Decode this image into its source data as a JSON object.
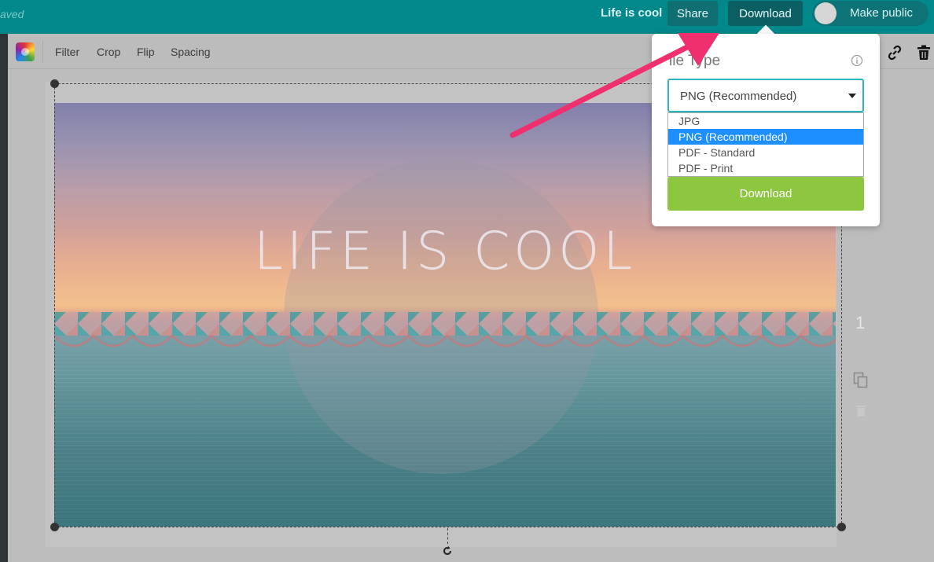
{
  "header": {
    "saved_text": "aved",
    "doc_title": "Life is cool",
    "share_label": "Share",
    "download_label": "Download",
    "make_public_label": "Make public"
  },
  "toolbar": {
    "items": [
      "Filter",
      "Crop",
      "Flip",
      "Spacing"
    ]
  },
  "design": {
    "headline": "LIFE IS COOL"
  },
  "page_number": "1",
  "download_popover": {
    "file_type_label": "ile Type",
    "selected_value": "PNG (Recommended)",
    "options": [
      "JPG",
      "PNG (Recommended)",
      "PDF - Standard",
      "PDF - Print"
    ],
    "highlighted_option": "PNG (Recommended)",
    "download_button": "Download"
  },
  "colors": {
    "topbar": "#00888b",
    "select_border": "#2ab7bd",
    "option_highlight": "#1e8fff",
    "download_button": "#8dc63f",
    "annotation_arrow": "#f0306e"
  }
}
